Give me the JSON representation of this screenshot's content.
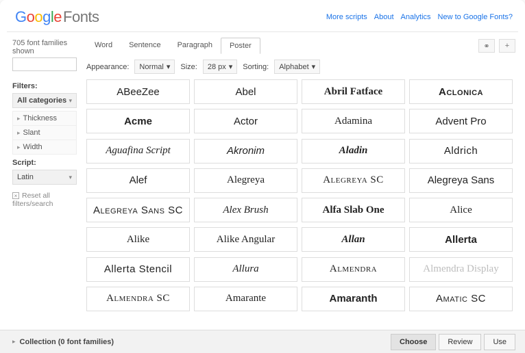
{
  "header": {
    "logo_rest": "Fonts",
    "links": [
      "More scripts",
      "About",
      "Analytics",
      "New to Google Fonts?"
    ]
  },
  "sidebar": {
    "count_text": "705 font families shown",
    "filters_label": "Filters:",
    "category_value": "All categories",
    "filter_rows": [
      "Thickness",
      "Slant",
      "Width"
    ],
    "script_label": "Script:",
    "script_value": "Latin",
    "reset_label": "Reset all filters/search"
  },
  "tabs": {
    "items": [
      "Word",
      "Sentence",
      "Paragraph",
      "Poster"
    ],
    "active": 3
  },
  "controls": {
    "appearance_label": "Appearance:",
    "appearance_value": "Normal",
    "size_label": "Size:",
    "size_value": "28 px",
    "sorting_label": "Sorting:",
    "sorting_value": "Alphabet"
  },
  "fonts": [
    {
      "name": "ABeeZee",
      "cls": "f-sans"
    },
    {
      "name": "Abel",
      "cls": "f-sans f-thin"
    },
    {
      "name": "Abril Fatface",
      "cls": "f-serif f-heavy"
    },
    {
      "name": "Aclonica",
      "cls": "f-sans f-bold f-sc"
    },
    {
      "name": "Acme",
      "cls": "f-sans f-heavy"
    },
    {
      "name": "Actor",
      "cls": "f-sans"
    },
    {
      "name": "Adamina",
      "cls": "f-serif"
    },
    {
      "name": "Advent Pro",
      "cls": "f-sans f-thin"
    },
    {
      "name": "Aguafina Script",
      "cls": "f-script"
    },
    {
      "name": "Akronim",
      "cls": "f-sans f-italic"
    },
    {
      "name": "Aladin",
      "cls": "f-serif f-bold f-italic"
    },
    {
      "name": "Aldrich",
      "cls": "f-sans f-cond"
    },
    {
      "name": "Alef",
      "cls": "f-sans"
    },
    {
      "name": "Alegreya",
      "cls": "f-serif"
    },
    {
      "name": "Alegreya SC",
      "cls": "f-serif f-sc"
    },
    {
      "name": "Alegreya Sans",
      "cls": "f-sans"
    },
    {
      "name": "Alegreya Sans SC",
      "cls": "f-sans f-sc"
    },
    {
      "name": "Alex Brush",
      "cls": "f-script"
    },
    {
      "name": "Alfa Slab One",
      "cls": "f-serif f-heavy"
    },
    {
      "name": "Alice",
      "cls": "f-serif"
    },
    {
      "name": "Alike",
      "cls": "f-serif"
    },
    {
      "name": "Alike Angular",
      "cls": "f-serif"
    },
    {
      "name": "Allan",
      "cls": "f-serif f-bold f-italic"
    },
    {
      "name": "Allerta",
      "cls": "f-sans f-bold"
    },
    {
      "name": "Allerta Stencil",
      "cls": "f-sans f-cond"
    },
    {
      "name": "Allura",
      "cls": "f-script"
    },
    {
      "name": "Almendra",
      "cls": "f-serif f-sc"
    },
    {
      "name": "Almendra Display",
      "cls": "f-serif f-light"
    },
    {
      "name": "Almendra SC",
      "cls": "f-serif f-sc"
    },
    {
      "name": "Amarante",
      "cls": "f-serif"
    },
    {
      "name": "Amaranth",
      "cls": "f-sans f-bold"
    },
    {
      "name": "Amatic SC",
      "cls": "f-sans f-sc f-cond"
    }
  ],
  "footer": {
    "collection_text": "Collection (0 font families)",
    "choose": "Choose",
    "review": "Review",
    "use": "Use"
  }
}
